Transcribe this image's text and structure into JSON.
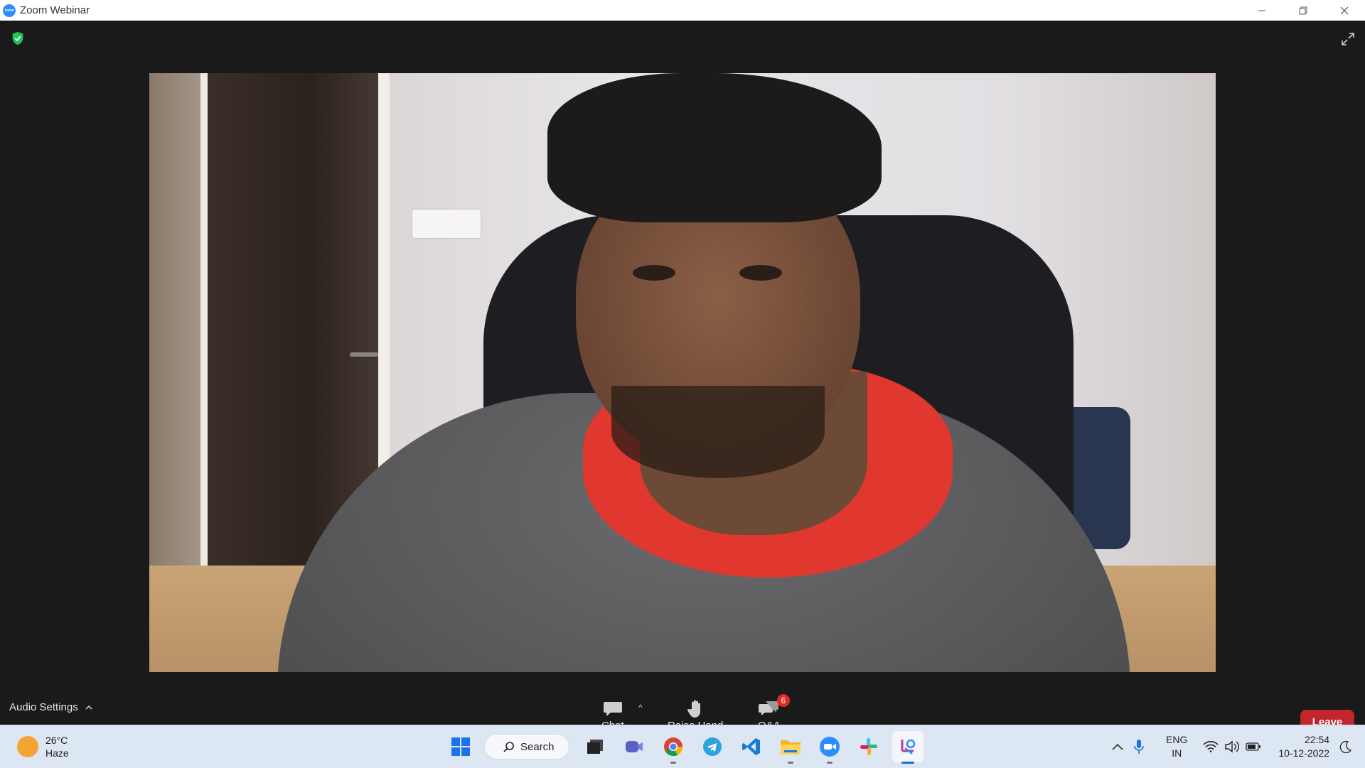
{
  "window": {
    "title": "Zoom Webinar",
    "logo_text": "zoom"
  },
  "toolbar": {
    "audio_settings_label": "Audio Settings",
    "chat_label": "Chat",
    "raise_hand_label": "Raise Hand",
    "qa_label": "Q&A",
    "qa_badge_count": "6",
    "leave_label": "Leave"
  },
  "taskbar": {
    "weather": {
      "temp": "26°C",
      "condition": "Haze"
    },
    "search_label": "Search",
    "apps": [
      "start-icon",
      "search",
      "task-view-icon",
      "teams-icon",
      "chrome-icon",
      "telegram-icon",
      "vscode-icon",
      "file-explorer-icon",
      "zoom-icon",
      "slack-icon",
      "snipping-tool-icon"
    ],
    "lang": {
      "line1": "ENG",
      "line2": "IN"
    },
    "clock": {
      "time": "22:54",
      "date": "10-12-2022"
    }
  },
  "colors": {
    "leave_button": "#c0262c",
    "qa_badge": "#e02828",
    "shield": "#21c55d",
    "meeting_bg": "#1a1a1a",
    "taskbar_bg": "#dde6f3"
  }
}
